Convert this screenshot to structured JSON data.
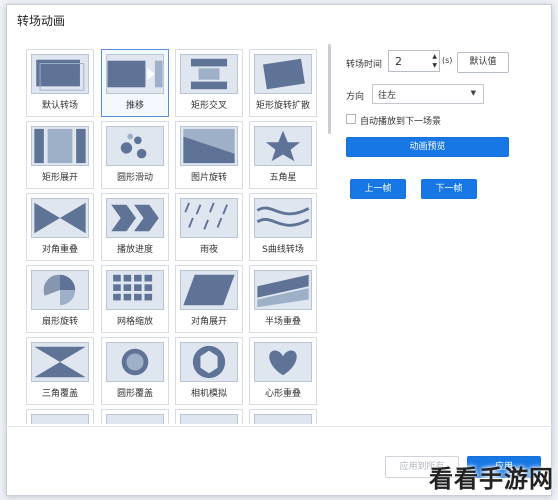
{
  "window": {
    "title": "转场动画"
  },
  "transitions": [
    {
      "label": "默认转场",
      "icon": "default-transition-icon",
      "selected": false
    },
    {
      "label": "推移",
      "icon": "push-icon",
      "selected": true
    },
    {
      "label": "矩形交叉",
      "icon": "rect-cross-icon",
      "selected": false
    },
    {
      "label": "矩形旋转扩散",
      "icon": "rect-rotate-spread-icon",
      "selected": false
    },
    {
      "label": "矩形展开",
      "icon": "rect-expand-icon",
      "selected": false
    },
    {
      "label": "圆形滑动",
      "icon": "circle-slide-icon",
      "selected": false
    },
    {
      "label": "图片旋转",
      "icon": "image-rotate-icon",
      "selected": false
    },
    {
      "label": "五角星",
      "icon": "star-icon",
      "selected": false
    },
    {
      "label": "对角重叠",
      "icon": "diagonal-overlap-icon",
      "selected": false
    },
    {
      "label": "播放进度",
      "icon": "play-progress-icon",
      "selected": false
    },
    {
      "label": "雨夜",
      "icon": "rainy-night-icon",
      "selected": false
    },
    {
      "label": "S曲线转场",
      "icon": "s-curve-icon",
      "selected": false
    },
    {
      "label": "扇形旋转",
      "icon": "fan-rotate-icon",
      "selected": false
    },
    {
      "label": "网格缩放",
      "icon": "grid-zoom-icon",
      "selected": false
    },
    {
      "label": "对角展开",
      "icon": "diagonal-expand-icon",
      "selected": false
    },
    {
      "label": "半场重叠",
      "icon": "half-overlap-icon",
      "selected": false
    },
    {
      "label": "三角覆盖",
      "icon": "triangle-cover-icon",
      "selected": false
    },
    {
      "label": "圆形覆盖",
      "icon": "circle-cover-icon",
      "selected": false
    },
    {
      "label": "相机模拟",
      "icon": "camera-aperture-icon",
      "selected": false
    },
    {
      "label": "心形重叠",
      "icon": "heart-overlap-icon",
      "selected": false
    }
  ],
  "settings": {
    "duration_label": "转场时间",
    "duration_value": "2",
    "duration_unit": "(s)",
    "default_button": "默认值",
    "direction_label": "方向",
    "direction_value": "往左",
    "autoplay_label": "自动播放到下一场景",
    "preview_button": "动画预览",
    "prev_button": "上一帧",
    "next_button": "下一帧"
  },
  "footer": {
    "apply_all": "应用到所有",
    "apply": "应用"
  },
  "watermark": "看看手游网",
  "colors": {
    "accent": "#1677e5",
    "thumb_fill": "#5f7396",
    "thumb_bg": "#dfe6f0"
  }
}
